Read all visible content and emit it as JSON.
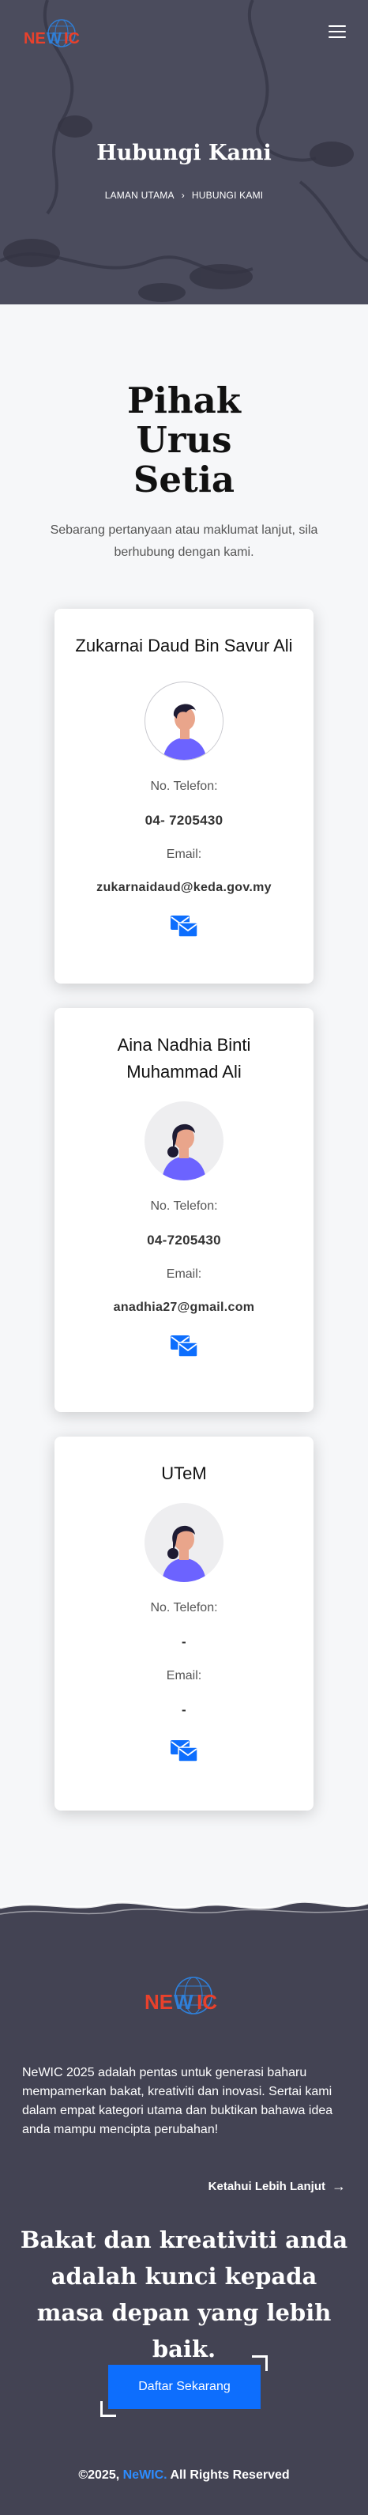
{
  "header": {
    "logo_text": "NEWIC",
    "menu_icon": "hamburger-icon"
  },
  "hero": {
    "title": "Hubungi Kami",
    "breadcrumb": {
      "home": "LAMAN UTAMA",
      "separator": "›",
      "current": "HUBUNGI KAMI"
    }
  },
  "section": {
    "title_line1": "Pihak",
    "title_line2": "Urus",
    "title_line3": "Setia",
    "subtitle": "Sebarang pertanyaan atau maklumat lanjut, sila berhubung dengan kami."
  },
  "contacts": [
    {
      "name": "Zukarnai Daud Bin Savur Ali",
      "phone_label": "No. Telefon:",
      "phone": "04- 7205430",
      "email_label": "Email:",
      "email": "zukarnaidaud@keda.gov.my",
      "avatar": "male-avatar-icon",
      "action_icon": "mail-send-icon"
    },
    {
      "name": "Aina Nadhia Binti Muhammad Ali",
      "phone_label": "No. Telefon:",
      "phone": "04-7205430",
      "email_label": "Email:",
      "email": "anadhia27@gmail.com",
      "avatar": "female-avatar-icon",
      "action_icon": "mail-send-icon"
    },
    {
      "name": "UTeM",
      "phone_label": "No. Telefon:",
      "phone": "-",
      "email_label": "Email:",
      "email": "-",
      "avatar": "female-avatar-icon",
      "action_icon": "mail-send-icon"
    }
  ],
  "footer": {
    "logo_text": "NEWIC",
    "description": "NeWIC 2025 adalah pentas untuk generasi baharu mempamerkan bakat, kreativiti dan inovasi. Sertai kami dalam empat kategori utama dan buktikan bahawa idea anda mampu mencipta perubahan!",
    "learn_more": "Ketahui Lebih Lanjut",
    "tagline": "Bakat dan kreativiti anda adalah kunci kepada masa depan yang lebih baik.",
    "cta": "Daftar Sekarang",
    "copyright_prefix": "©2025,",
    "copyright_brand": "NeWIC.",
    "copyright_suffix": "All Rights Reserved"
  },
  "colors": {
    "accent": "#0d6efd",
    "brand_blue": "#2c8cff",
    "footer_bg": "#434353",
    "hero_bg": "#5b5c6c",
    "logo_red": "#e8412c",
    "logo_blue": "#2f7fd8"
  }
}
